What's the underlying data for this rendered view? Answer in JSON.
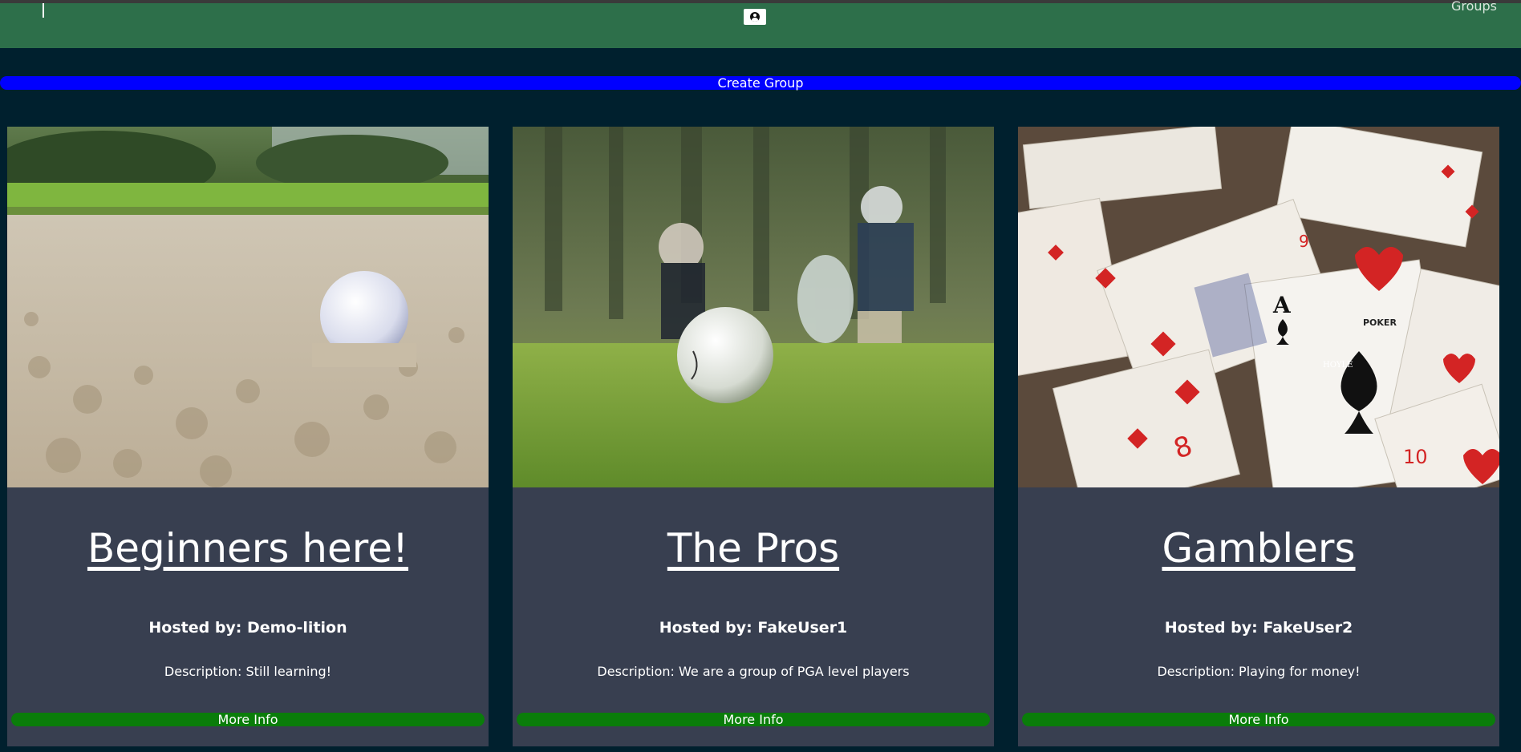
{
  "nav": {
    "groups_label": "Groups"
  },
  "create_group": {
    "label": "Create Group"
  },
  "groups": [
    {
      "name": "Beginners here!",
      "host": "Hosted by: Demo-lition",
      "description": "Description: Still learning!",
      "button": "More Info",
      "image": "golf-ball-in-sand-photo"
    },
    {
      "name": "The Pros",
      "host": "Hosted by: FakeUser1",
      "description": "Description: We are a group of PGA level players",
      "button": "More Info",
      "image": "golf-ball-on-grass-photo"
    },
    {
      "name": "Gamblers",
      "host": "Hosted by: FakeUser2",
      "description": "Description: Playing for money!",
      "button": "More Info",
      "image": "playing-cards-photo"
    }
  ],
  "colors": {
    "background": "#00202e",
    "navbar": "#2d6f4a",
    "create_button": "#0000ff",
    "card": "#383f50",
    "more_info_button": "#0a7d0a"
  }
}
